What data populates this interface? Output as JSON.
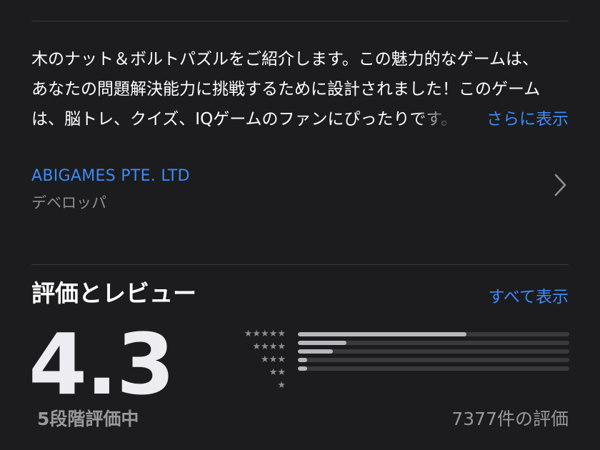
{
  "description": {
    "lines": [
      "木のナット＆ボルトパズルをご紹介します。この魅力的なゲームは、",
      "あなたの問題解決能力に挑戦するために設計されました！このゲーム",
      "は、脳トレ、クイズ、IQゲームのファンにぴったりです。"
    ],
    "more_label": "さらに表示"
  },
  "developer": {
    "name": "ABIGAMES PTE. LTD",
    "role_label": "デベロッパ",
    "chevron_icon": "chevron-right-icon"
  },
  "ratings": {
    "title": "評価とレビュー",
    "see_all_label": "すべて表示",
    "average": "4.3",
    "out_of_label": "5段階評価中",
    "count_label": "7377件の評価",
    "distribution": [
      {
        "stars": "★★★★★",
        "fraction": 0.62
      },
      {
        "stars": "★★★★",
        "fraction": 0.18
      },
      {
        "stars": "★★★",
        "fraction": 0.13
      },
      {
        "stars": "★★",
        "fraction": 0.035
      },
      {
        "stars": "★",
        "fraction": 0.035
      }
    ]
  },
  "colors": {
    "background": "#1c1c1e",
    "link": "#3d8af7",
    "secondary_text": "#8e8e93",
    "bar_fill": "#b7b7bc",
    "bar_track": "#3a3a3c"
  }
}
